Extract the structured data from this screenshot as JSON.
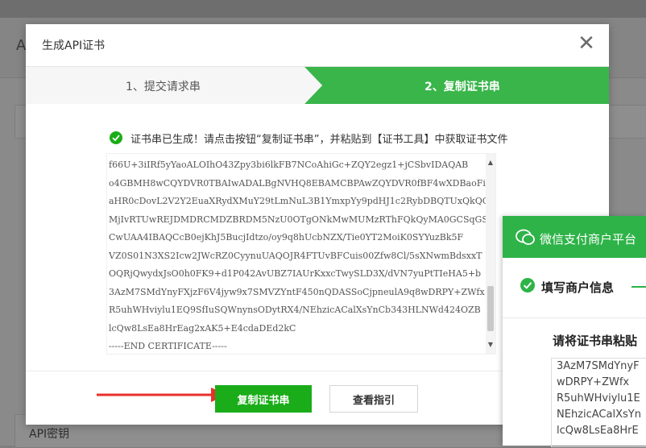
{
  "background": {
    "heading_letter": "A",
    "section_label": "API密钥"
  },
  "modal": {
    "title": "生成API证书",
    "close_glyph": "✕",
    "steps": [
      {
        "label": "1、提交请求串"
      },
      {
        "label": "2、复制证书串"
      }
    ],
    "message": "证书串已生成！请点击按钮“复制证书串”，并粘贴到【证书工具】中获取证书文件",
    "certificate_lines": [
      "f66U+3iIRf5yYaoALOIhO43Zpy3bi6lkFB7NCoAhiGc+ZQY2egz1+jCSbvIDAQAB",
      "o4GBMH8wCQYDVR0TBAIwADALBgNVHQ8EBAMCBPAwZQYDVR0fBF4wXDBaoFigVoZU",
      "aHR0cDovL2V2Y2EuaXRydXMuY29tLmNuL3B1YmxpYy9pdHJ1c2RybDBQTUxQkQQ",
      "MjIvRTUwREJDMDRCMDZBRDM5NzU0OTgONkMwMUMzRThFQkQyMA0GCSqGSIb3DQEB",
      "CwUAA4IBAQCcB0ejKhJ5BucjIdtzo/oy9q8hUcbNZX/Tie0YT2MoiK0SYYuzBk5F",
      "VZ0S01N3XS2Icw2JWcRZ0CyynuUAQOJR4FTUvBFCuis00Zfw8Cl/5sXNwmBdsxxT",
      "OQRjQwydxJsO0h0FK9+d1P042AvUBZ7IAUrKxxcTwySLD3X/dVN7yuPtTIeHA5+b",
      "3AzM7SMdYnyFXjzF6V4jyw9x7SMVZYntF450nQDASSoCjpneulA9q8wDRPY+ZWfx",
      "R5uhWHviylu1EQ9SfIuSQWnynsODytRX4/NEhzicACalXsYnCb343HLNWd424OZB",
      "lcQw8LsEa8HrEag2xAK5+E4cdaDEd2kC",
      "-----END CERTIFICATE-----"
    ],
    "buttons": {
      "copy": "复制证书串",
      "guide": "查看指引"
    }
  },
  "tool": {
    "title": "微信支付商户平台",
    "step": "填写商户信息",
    "prompt": "请将证书串粘贴",
    "input_lines": [
      "3AzM7SMdYnyF",
      "wDRPY+ZWfx",
      "R5uhWHviylu1E",
      "NEhzicACalXsYn",
      "lcQw8LsEa8HrE"
    ]
  },
  "colors": {
    "brand_green": "#1aad19",
    "step_green": "#39b54a",
    "arrow_red": "#e8312a"
  }
}
